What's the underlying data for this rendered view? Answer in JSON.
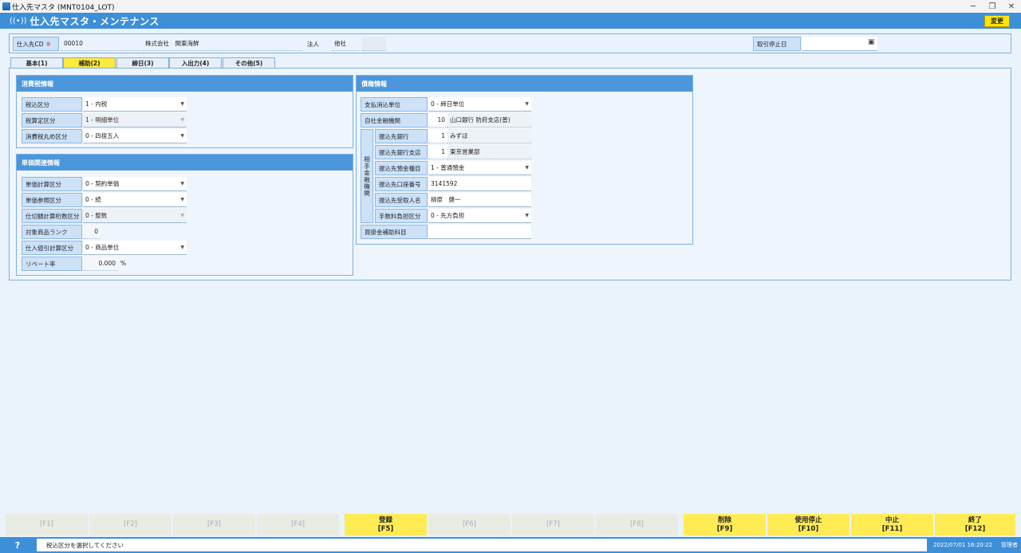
{
  "window": {
    "title": "仕入先マスタ (MNT0104_LOT)"
  },
  "header": {
    "title": "仕入先マスタ・メンテナンス",
    "change_button": "変更"
  },
  "top": {
    "code_label": "仕入先CD",
    "required_mark": "※",
    "code_value": "00010",
    "name_value": "株式会社　関東海鮮",
    "type_label": "法人",
    "type_value": "他社",
    "stop_date_label": "取引停止日",
    "stop_date_value": ""
  },
  "tabs": [
    {
      "label": "基本(1)",
      "active": false
    },
    {
      "label": "補助(2)",
      "active": true
    },
    {
      "label": "締日(3)",
      "active": false
    },
    {
      "label": "入出力(4)",
      "active": false
    },
    {
      "label": "その他(5)",
      "active": false
    }
  ],
  "tax": {
    "title": "消費税情報",
    "rows": [
      {
        "label": "税込区分",
        "value": "1 - 内税"
      },
      {
        "label": "税算定区分",
        "value": "1 - 明細単位"
      },
      {
        "label": "消費税丸め区分",
        "value": "0 - 四捨五入"
      }
    ]
  },
  "price": {
    "title": "単価関連情報",
    "rows": [
      {
        "label": "単価計算区分",
        "value": "0 - 契約単価"
      },
      {
        "label": "単価参照区分",
        "value": "0 - 続"
      },
      {
        "label": "仕切額計算桁数区分",
        "value": "0 - 整数"
      },
      {
        "label": "対象商品ランク",
        "value": "0"
      },
      {
        "label": "仕入値引計算区分",
        "value": "0 - 商品単位"
      },
      {
        "label": "リベート率",
        "value": "0.000"
      }
    ],
    "percent": "%"
  },
  "debt": {
    "title": "債権情報",
    "pay_unit_label": "支払消込単位",
    "pay_unit_value": "0 - 締日単位",
    "own_bank_label": "自社金融機関",
    "own_bank_code": "10",
    "own_bank_name": "山口銀行 防府支店(普)",
    "partner_label": "相手金融機関",
    "bank_label": "振込先銀行",
    "bank_code": "1",
    "bank_name": "みずほ",
    "branch_label": "振込先銀行支店",
    "branch_code": "1",
    "branch_name": "東京営業部",
    "deposit_label": "振込先預金種目",
    "deposit_value": "1 - 普通預金",
    "account_label": "振込先口座番号",
    "account_value": "3141592",
    "holder_label": "振込先受取人名",
    "holder_value": "柳原　健一",
    "fee_label": "手数料負担区分",
    "fee_value": "0 - 先方負担",
    "aux_label": "買掛金補助科目",
    "aux_value": ""
  },
  "fkeys": [
    {
      "label": "",
      "key": "[F1]",
      "enabled": false
    },
    {
      "label": "",
      "key": "[F2]",
      "enabled": false
    },
    {
      "label": "",
      "key": "[F3]",
      "enabled": false
    },
    {
      "label": "",
      "key": "[F4]",
      "enabled": false
    },
    {
      "label": "登録",
      "key": "[F5]",
      "enabled": true
    },
    {
      "label": "",
      "key": "[F6]",
      "enabled": false
    },
    {
      "label": "",
      "key": "[F7]",
      "enabled": false
    },
    {
      "label": "",
      "key": "[F8]",
      "enabled": false
    },
    {
      "label": "削除",
      "key": "[F9]",
      "enabled": true
    },
    {
      "label": "使用停止",
      "key": "[F10]",
      "enabled": true
    },
    {
      "label": "中止",
      "key": "[F11]",
      "enabled": true
    },
    {
      "label": "終了",
      "key": "[F12]",
      "enabled": true
    }
  ],
  "status": {
    "help": "?",
    "message": "税込区分を選択してください",
    "datetime": "2022/07/01 16:20:22",
    "user": "管理者"
  },
  "colors": {
    "accent": "#3d8fd8",
    "highlight": "#ffe500"
  }
}
